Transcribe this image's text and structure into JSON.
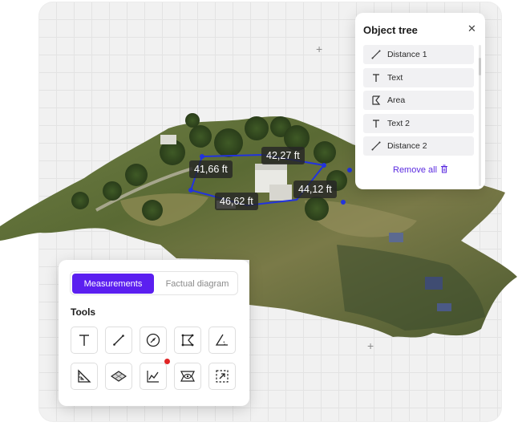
{
  "measurements": {
    "distance_a": "42,27 ft",
    "distance_b": "41,66 ft",
    "distance_c": "44,12 ft",
    "distance_d": "46,62 ft"
  },
  "object_tree": {
    "title": "Object tree",
    "close_icon": "close-icon",
    "items": [
      {
        "icon": "ruler-line-icon",
        "label": "Distance 1"
      },
      {
        "icon": "text-icon",
        "label": "Text"
      },
      {
        "icon": "area-polygon-icon",
        "label": "Area"
      },
      {
        "icon": "text-icon",
        "label": "Text 2"
      },
      {
        "icon": "ruler-line-icon",
        "label": "Distance 2"
      }
    ],
    "remove_all_label": "Remove all",
    "remove_all_icon": "trash-icon"
  },
  "tools_panel": {
    "tabs": [
      {
        "label": "Measurements",
        "active": true
      },
      {
        "label": "Factual diagram",
        "active": false
      }
    ],
    "section_title": "Tools",
    "tools": [
      {
        "icon": "text-icon"
      },
      {
        "icon": "line-distance-icon"
      },
      {
        "icon": "compass-direction-icon"
      },
      {
        "icon": "polygon-area-icon"
      },
      {
        "icon": "angle-icon"
      },
      {
        "icon": "ruler-triangle-icon"
      },
      {
        "icon": "surface-layer-icon"
      },
      {
        "icon": "elevation-profile-icon",
        "badge": true
      },
      {
        "icon": "view-eye-icon"
      },
      {
        "icon": "crop-select-icon"
      }
    ]
  },
  "colors": {
    "accent": "#5b1ff0",
    "link": "#5b2be0",
    "measurement_line": "#2233dd",
    "badge": "#e02424"
  }
}
